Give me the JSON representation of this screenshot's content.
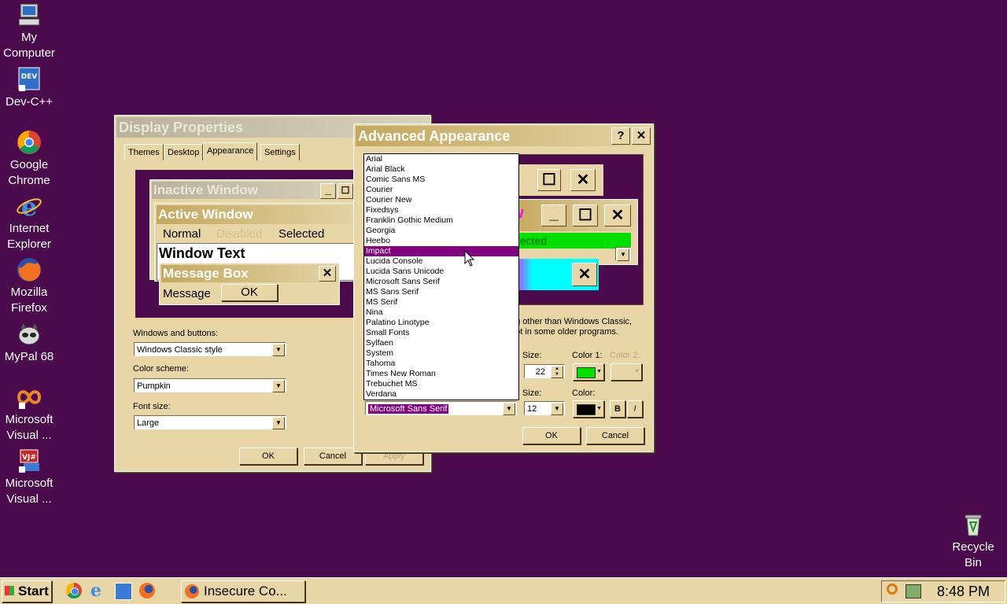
{
  "desktop": {
    "icons": [
      {
        "label1": "My",
        "label2": "Computer",
        "icon": "my-computer-icon"
      },
      {
        "label1": "Dev-C++",
        "label2": "",
        "icon": "devcpp-icon"
      },
      {
        "label1": "Google",
        "label2": "Chrome",
        "icon": "chrome-icon"
      },
      {
        "label1": "Internet",
        "label2": "Explorer",
        "icon": "ie-icon"
      },
      {
        "label1": "Mozilla",
        "label2": "Firefox",
        "icon": "firefox-icon"
      },
      {
        "label1": "MyPal 68",
        "label2": "",
        "icon": "mypal-icon"
      },
      {
        "label1": "Microsoft",
        "label2": "Visual ...",
        "icon": "visual-studio-icon"
      },
      {
        "label1": "Microsoft",
        "label2": "Visual ...",
        "icon": "visual-jsharp-icon"
      },
      {
        "label1": "Recycle",
        "label2": "Bin",
        "icon": "recycle-bin-icon"
      }
    ]
  },
  "display": {
    "title": "Display Properties",
    "tabs": [
      "Themes",
      "Desktop",
      "Appearance",
      "Settings"
    ],
    "preview": {
      "inactive": "Inactive Window",
      "active": "Active Window",
      "normal": "Normal",
      "disabled": "Disabled",
      "selected": "Selected",
      "window_text": "Window Text",
      "msgbox_title": "Message Box",
      "msgbox_text": "Message",
      "ok": "OK"
    },
    "windows_buttons_label": "Windows and buttons:",
    "windows_buttons_value": "Windows Classic style",
    "color_scheme_label": "Color scheme:",
    "color_scheme_value": "Pumpkin",
    "font_size_label": "Font size:",
    "font_size_value": "Large",
    "ok": "OK",
    "cancel": "Cancel",
    "apply": "Apply"
  },
  "advanced": {
    "title": "Advanced Appearance",
    "help": "?",
    "close": "✕",
    "preview_w": "w",
    "preview_selected": "elected",
    "note_line1": "ng other than Windows Classic,",
    "note_line2": "ept in some older programs.",
    "size_label": "Size:",
    "size_value": "22",
    "color1_label": "Color 1:",
    "color2_label": "Color 2:",
    "font_size_label": "Size:",
    "font_size_value": "12",
    "color_label": "Color:",
    "bold": "B",
    "italic": "I",
    "font_value": "Microsoft Sans Serif",
    "ok": "OK",
    "cancel": "Cancel",
    "fonts": [
      "Arial",
      "Arial Black",
      "Comic Sans MS",
      "Courier",
      "Courier New",
      "Fixedsys",
      "Franklin Gothic Medium",
      "Georgia",
      "Heebo",
      "Impact",
      "Lucida Console",
      "Lucida Sans Unicode",
      "Microsoft Sans Serif",
      "MS Sans Serif",
      "MS Serif",
      "Nina",
      "Palatino Linotype",
      "Small Fonts",
      "Sylfaen",
      "System",
      "Tahoma",
      "Times New Roman",
      "Trebuchet MS",
      "Verdana"
    ],
    "highlighted_font": "Impact",
    "color1": "#00e000",
    "color": "#000000"
  },
  "taskbar": {
    "start": "Start",
    "task": "Insecure Co...",
    "clock": "8:48 PM"
  },
  "colors": {
    "desktop": "#4b0a4b",
    "face": "#e8d6a6",
    "highlight": "#800080"
  }
}
